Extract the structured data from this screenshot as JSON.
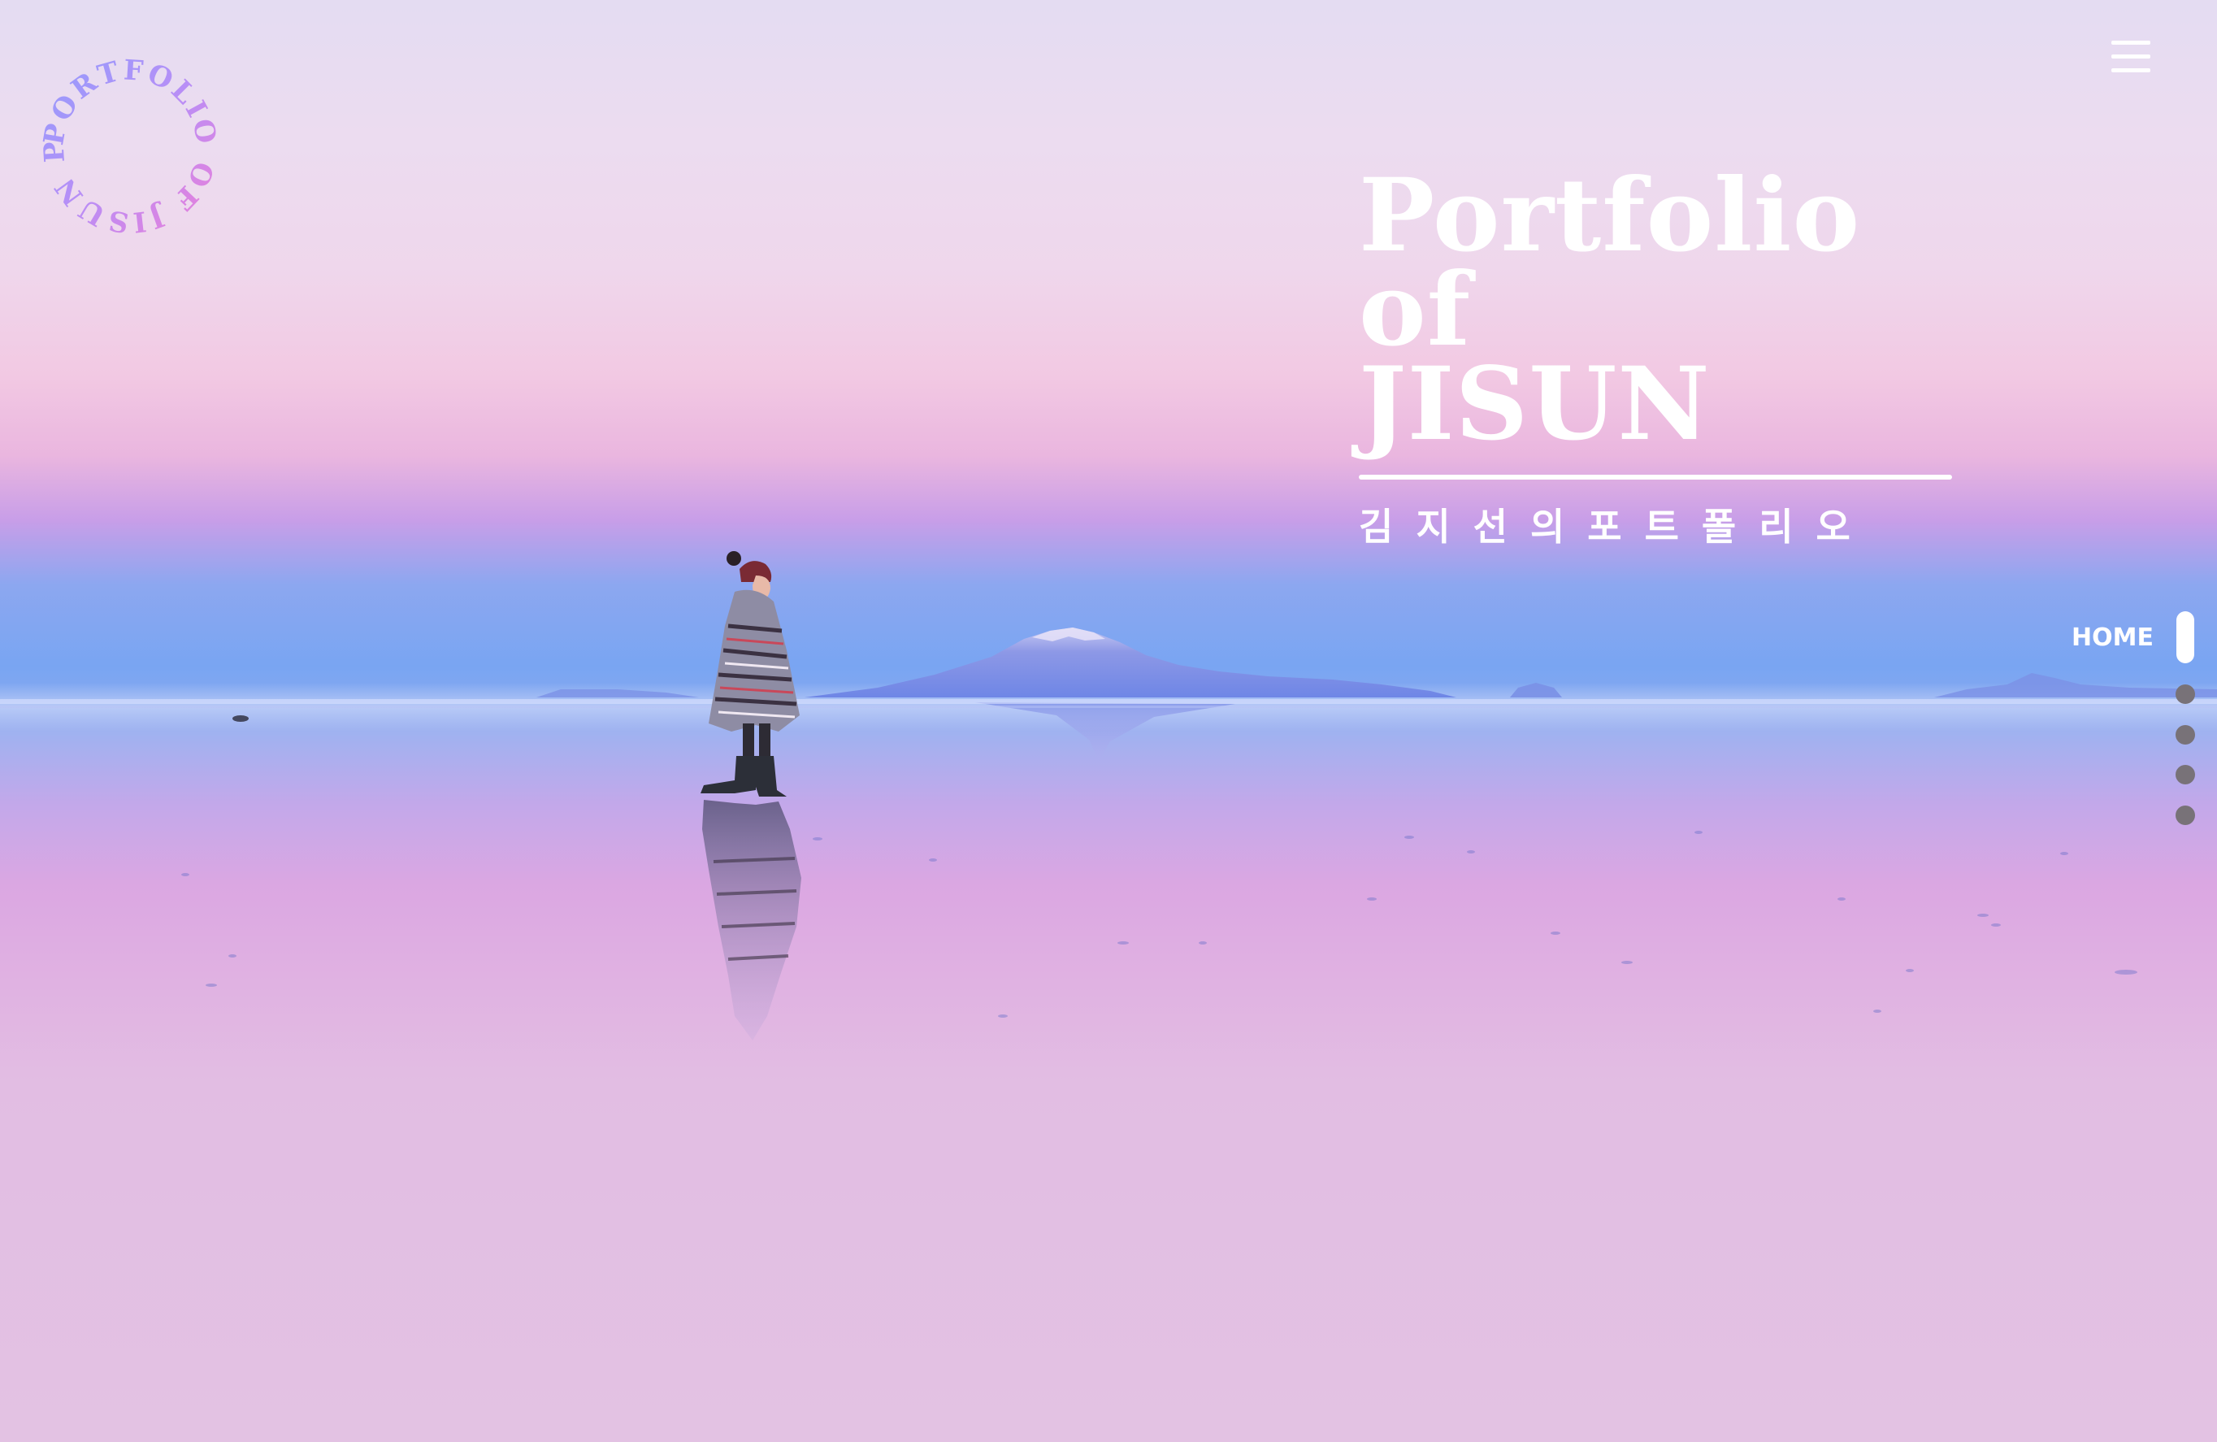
{
  "logo": {
    "ring_text": "PORTFOLIO OF JISUN PORTFOLIO"
  },
  "header": {
    "menu_icon": "hamburger-menu-icon"
  },
  "hero": {
    "title_line1": "Portfolio of",
    "title_line2": "JISUN",
    "subtitle": "김지선의포트폴리오"
  },
  "side_nav": {
    "items": [
      {
        "label": "HOME",
        "active": true
      },
      {
        "label": "",
        "active": false
      },
      {
        "label": "",
        "active": false
      },
      {
        "label": "",
        "active": false
      },
      {
        "label": "",
        "active": false
      }
    ]
  },
  "colors": {
    "text": "#ffffff",
    "dot_inactive": "#787278",
    "logo_gradient_start": "#8aa0ff",
    "logo_gradient_end": "#f07ed6"
  }
}
